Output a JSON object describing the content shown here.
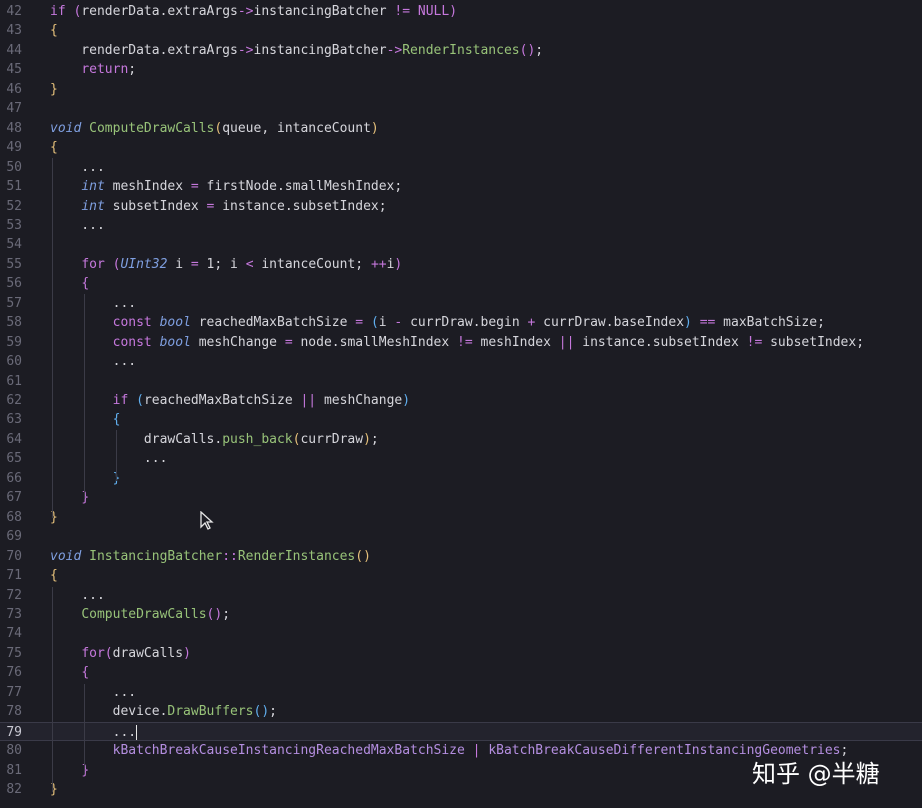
{
  "editor": {
    "current_line": "79",
    "watermark": "知乎 @半糖",
    "lines": [
      {
        "no": "42",
        "parts": [
          [
            "if",
            "kw"
          ],
          [
            " ",
            ""
          ],
          [
            "(",
            "b2"
          ],
          [
            "renderData.extraArgs",
            ""
          ],
          [
            "->",
            "op"
          ],
          [
            "instancingBatcher ",
            ""
          ],
          [
            "!=",
            "op"
          ],
          [
            " NULL",
            "cn"
          ],
          [
            ")",
            "b2"
          ]
        ]
      },
      {
        "no": "43",
        "parts": [
          [
            "{",
            "b1"
          ]
        ]
      },
      {
        "no": "44",
        "parts": [
          [
            "    renderData.extraArgs",
            ""
          ],
          [
            "->",
            "op"
          ],
          [
            "instancingBatcher",
            ""
          ],
          [
            "->",
            "op"
          ],
          [
            "RenderInstances",
            "fn"
          ],
          [
            "()",
            "b2"
          ],
          [
            ";",
            ""
          ]
        ]
      },
      {
        "no": "45",
        "parts": [
          [
            "    ",
            ""
          ],
          [
            "return",
            "kw"
          ],
          [
            ";",
            ""
          ]
        ]
      },
      {
        "no": "46",
        "parts": [
          [
            "}",
            "b1"
          ]
        ]
      },
      {
        "no": "47",
        "parts": []
      },
      {
        "no": "48",
        "parts": [
          [
            "void",
            "ty"
          ],
          [
            " ",
            ""
          ],
          [
            "ComputeDrawCalls",
            "fn"
          ],
          [
            "(",
            "b1"
          ],
          [
            "queue, intanceCount",
            ""
          ],
          [
            ")",
            "b1"
          ]
        ]
      },
      {
        "no": "49",
        "parts": [
          [
            "{",
            "b1"
          ]
        ]
      },
      {
        "no": "50",
        "parts": [
          [
            "    ...",
            ""
          ]
        ]
      },
      {
        "no": "51",
        "parts": [
          [
            "    ",
            ""
          ],
          [
            "int",
            "ty"
          ],
          [
            " meshIndex ",
            ""
          ],
          [
            "=",
            "op"
          ],
          [
            " firstNode.smallMeshIndex;",
            ""
          ]
        ]
      },
      {
        "no": "52",
        "parts": [
          [
            "    ",
            ""
          ],
          [
            "int",
            "ty"
          ],
          [
            " subsetIndex ",
            ""
          ],
          [
            "=",
            "op"
          ],
          [
            " instance.subsetIndex;",
            ""
          ]
        ]
      },
      {
        "no": "53",
        "parts": [
          [
            "    ...",
            ""
          ]
        ]
      },
      {
        "no": "54",
        "parts": []
      },
      {
        "no": "55",
        "parts": [
          [
            "    ",
            ""
          ],
          [
            "for",
            "kw"
          ],
          [
            " ",
            ""
          ],
          [
            "(",
            "b2"
          ],
          [
            "UInt32",
            "ty"
          ],
          [
            " i ",
            ""
          ],
          [
            "=",
            "op"
          ],
          [
            " 1; i ",
            ""
          ],
          [
            "<",
            "op"
          ],
          [
            " intanceCount; ",
            ""
          ],
          [
            "++",
            "op"
          ],
          [
            "i",
            ""
          ],
          [
            ")",
            "b2"
          ]
        ]
      },
      {
        "no": "56",
        "parts": [
          [
            "    ",
            ""
          ],
          [
            "{",
            "b2"
          ]
        ]
      },
      {
        "no": "57",
        "parts": [
          [
            "        ...",
            ""
          ]
        ]
      },
      {
        "no": "58",
        "parts": [
          [
            "        ",
            ""
          ],
          [
            "const",
            "kw"
          ],
          [
            " ",
            ""
          ],
          [
            "bool",
            "ty"
          ],
          [
            " reachedMaxBatchSize ",
            ""
          ],
          [
            "=",
            "op"
          ],
          [
            " ",
            ""
          ],
          [
            "(",
            "b3"
          ],
          [
            "i ",
            ""
          ],
          [
            "-",
            "op"
          ],
          [
            " currDraw.begin ",
            ""
          ],
          [
            "+",
            "op"
          ],
          [
            " currDraw.baseIndex",
            ""
          ],
          [
            ")",
            "b3"
          ],
          [
            " ",
            ""
          ],
          [
            "==",
            "op"
          ],
          [
            " maxBatchSize;",
            ""
          ]
        ]
      },
      {
        "no": "59",
        "parts": [
          [
            "        ",
            ""
          ],
          [
            "const",
            "kw"
          ],
          [
            " ",
            ""
          ],
          [
            "bool",
            "ty"
          ],
          [
            " meshChange ",
            ""
          ],
          [
            "=",
            "op"
          ],
          [
            " node.smallMeshIndex ",
            ""
          ],
          [
            "!=",
            "op"
          ],
          [
            " meshIndex ",
            ""
          ],
          [
            "||",
            "op"
          ],
          [
            " instance.subsetIndex ",
            ""
          ],
          [
            "!=",
            "op"
          ],
          [
            " subsetIndex;",
            ""
          ]
        ]
      },
      {
        "no": "60",
        "parts": [
          [
            "        ...",
            ""
          ]
        ]
      },
      {
        "no": "61",
        "parts": []
      },
      {
        "no": "62",
        "parts": [
          [
            "        ",
            ""
          ],
          [
            "if",
            "kw"
          ],
          [
            " ",
            ""
          ],
          [
            "(",
            "b3"
          ],
          [
            "reachedMaxBatchSize ",
            ""
          ],
          [
            "||",
            "op"
          ],
          [
            " meshChange",
            ""
          ],
          [
            ")",
            "b3"
          ]
        ]
      },
      {
        "no": "63",
        "parts": [
          [
            "        ",
            ""
          ],
          [
            "{",
            "b3"
          ]
        ]
      },
      {
        "no": "64",
        "parts": [
          [
            "            drawCalls.",
            ""
          ],
          [
            "push_back",
            "fn"
          ],
          [
            "(",
            "b1"
          ],
          [
            "currDraw",
            ""
          ],
          [
            ")",
            "b1"
          ],
          [
            ";",
            ""
          ]
        ]
      },
      {
        "no": "65",
        "parts": [
          [
            "            ...",
            ""
          ]
        ]
      },
      {
        "no": "66",
        "parts": [
          [
            "        ",
            ""
          ],
          [
            "}",
            "b3"
          ]
        ]
      },
      {
        "no": "67",
        "parts": [
          [
            "    ",
            ""
          ],
          [
            "}",
            "b2"
          ]
        ]
      },
      {
        "no": "68",
        "parts": [
          [
            "}",
            "b1"
          ]
        ]
      },
      {
        "no": "69",
        "parts": []
      },
      {
        "no": "70",
        "parts": [
          [
            "void",
            "ty"
          ],
          [
            " ",
            ""
          ],
          [
            "InstancingBatcher",
            "fn"
          ],
          [
            "::",
            "op"
          ],
          [
            "RenderInstances",
            "fn"
          ],
          [
            "()",
            "b1"
          ]
        ]
      },
      {
        "no": "71",
        "parts": [
          [
            "{",
            "b1"
          ]
        ]
      },
      {
        "no": "72",
        "parts": [
          [
            "    ...",
            ""
          ]
        ]
      },
      {
        "no": "73",
        "parts": [
          [
            "    ",
            ""
          ],
          [
            "ComputeDrawCalls",
            "fn"
          ],
          [
            "()",
            "b2"
          ],
          [
            ";",
            ""
          ]
        ]
      },
      {
        "no": "74",
        "parts": []
      },
      {
        "no": "75",
        "parts": [
          [
            "    ",
            ""
          ],
          [
            "for",
            "kw"
          ],
          [
            "(",
            "b2"
          ],
          [
            "drawCalls",
            ""
          ],
          [
            ")",
            "b2"
          ]
        ]
      },
      {
        "no": "76",
        "parts": [
          [
            "    ",
            ""
          ],
          [
            "{",
            "b2"
          ]
        ]
      },
      {
        "no": "77",
        "parts": [
          [
            "        ...",
            ""
          ]
        ]
      },
      {
        "no": "78",
        "parts": [
          [
            "        device.",
            ""
          ],
          [
            "DrawBuffers",
            "fn"
          ],
          [
            "()",
            "b3"
          ],
          [
            ";",
            ""
          ]
        ]
      },
      {
        "no": "79",
        "parts": [
          [
            "        ...",
            ""
          ]
        ]
      },
      {
        "no": "80",
        "parts": [
          [
            "        ",
            ""
          ],
          [
            "kBatchBreakCauseInstancingReachedMaxBatchSize",
            "en"
          ],
          [
            " | ",
            "op"
          ],
          [
            "kBatchBreakCauseDifferentInstancingGeometries",
            "en"
          ],
          [
            ";",
            ""
          ]
        ]
      },
      {
        "no": "81",
        "parts": [
          [
            "    ",
            ""
          ],
          [
            "}",
            "b2"
          ]
        ]
      },
      {
        "no": "82",
        "parts": [
          [
            "}",
            "b1"
          ]
        ]
      }
    ]
  }
}
